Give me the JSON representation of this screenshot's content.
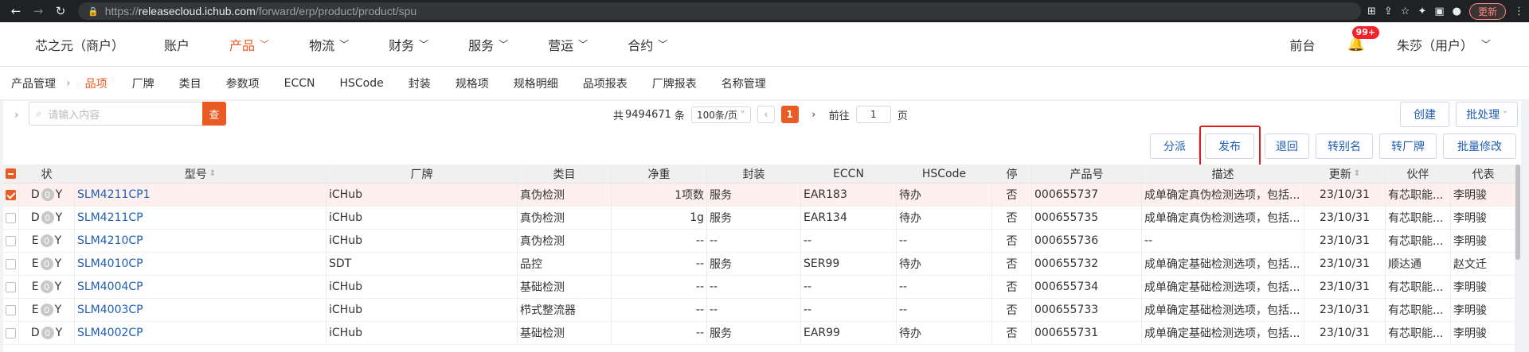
{
  "browser": {
    "url_prefix": "https://",
    "url_host": "releasecloud.ichub.com",
    "url_path": "/forward/erp/product/product/spu",
    "update_label": "更新"
  },
  "topnav": {
    "items": [
      {
        "label": "芯之元（商户）"
      },
      {
        "label": "账户"
      },
      {
        "label": "产品"
      },
      {
        "label": "物流"
      },
      {
        "label": "财务"
      },
      {
        "label": "服务"
      },
      {
        "label": "营运"
      },
      {
        "label": "合约"
      }
    ],
    "frontdesk": "前台",
    "badge": "99+",
    "user": "朱莎（用户）"
  },
  "subnav": {
    "root": "产品管理",
    "items": [
      "品项",
      "厂牌",
      "类目",
      "参数项",
      "ECCN",
      "HSCode",
      "封装",
      "规格项",
      "规格明细",
      "品项报表",
      "厂牌报表",
      "名称管理"
    ]
  },
  "toolbar": {
    "search_placeholder": "请输入内容",
    "search_btn": "查",
    "total_prefix": "共",
    "total": "9494671",
    "total_suffix": "条",
    "page_size": "100条/页",
    "current_page": "1",
    "goto_label": "前往",
    "goto_value": "1",
    "page_label": "页",
    "create": "创建",
    "batch": "批处理",
    "assign": "分派",
    "publish": "发布",
    "return": "退回",
    "alias": "转别名",
    "brand": "转厂牌",
    "batch_edit": "批量修改"
  },
  "table": {
    "headers": [
      "状",
      "型号",
      "厂牌",
      "类目",
      "净重",
      "封装",
      "ECCN",
      "HSCode",
      "停",
      "产品号",
      "描述",
      "更新",
      "伙伴",
      "代表"
    ],
    "rows": [
      {
        "sel": true,
        "s1": "D",
        "s2": "0",
        "s3": "Y",
        "model": "SLM4211CP1",
        "brand": "iCHub",
        "cat": "真伪检测",
        "weight": "1项数",
        "pkg": "服务",
        "eccn": "EAR183",
        "hs": "待办",
        "stop": "否",
        "pn": "000655737",
        "desc": "成单确定真伪检测选项，包括...",
        "upd": "23/10/31",
        "partner": "有芯职能...",
        "rep": "李明骏"
      },
      {
        "sel": false,
        "s1": "D",
        "s2": "0",
        "s3": "Y",
        "model": "SLM4211CP",
        "brand": "iCHub",
        "cat": "真伪检测",
        "weight": "1g",
        "pkg": "服务",
        "eccn": "EAR134",
        "hs": "待办",
        "stop": "否",
        "pn": "000655735",
        "desc": "成单确定真伪检测选项，包括...",
        "upd": "23/10/31",
        "partner": "有芯职能...",
        "rep": "李明骏"
      },
      {
        "sel": false,
        "s1": "E",
        "s2": "0",
        "s3": "Y",
        "model": "SLM4210CP",
        "brand": "iCHub",
        "cat": "真伪检测",
        "weight": "--",
        "pkg": "--",
        "eccn": "--",
        "hs": "--",
        "stop": "否",
        "pn": "000655736",
        "desc": "--",
        "upd": "23/10/31",
        "partner": "有芯职能...",
        "rep": "李明骏"
      },
      {
        "sel": false,
        "s1": "E",
        "s2": "0",
        "s3": "Y",
        "model": "SLM4010CP",
        "brand": "SDT",
        "cat": "品控",
        "weight": "--",
        "pkg": "服务",
        "eccn": "SER99",
        "hs": "待办",
        "stop": "否",
        "pn": "000655732",
        "desc": "成单确定基础检测选项，包括...",
        "upd": "23/10/31",
        "partner": "顺达通",
        "rep": "赵文迁"
      },
      {
        "sel": false,
        "s1": "E",
        "s2": "0",
        "s3": "Y",
        "model": "SLM4004CP",
        "brand": "iCHub",
        "cat": "基础检测",
        "weight": "--",
        "pkg": "--",
        "eccn": "--",
        "hs": "--",
        "stop": "否",
        "pn": "000655734",
        "desc": "成单确定基础检测选项，包括...",
        "upd": "23/10/31",
        "partner": "有芯职能...",
        "rep": "李明骏"
      },
      {
        "sel": false,
        "s1": "E",
        "s2": "0",
        "s3": "Y",
        "model": "SLM4003CP",
        "brand": "iCHub",
        "cat": "栉式整流器",
        "weight": "--",
        "pkg": "--",
        "eccn": "--",
        "hs": "--",
        "stop": "否",
        "pn": "000655733",
        "desc": "成单确定基础检测选项，包括...",
        "upd": "23/10/31",
        "partner": "有芯职能...",
        "rep": "李明骏"
      },
      {
        "sel": false,
        "s1": "D",
        "s2": "0",
        "s3": "Y",
        "model": "SLM4002CP",
        "brand": "iCHub",
        "cat": "基础检测",
        "weight": "--",
        "pkg": "服务",
        "eccn": "EAR99",
        "hs": "待办",
        "stop": "否",
        "pn": "000655731",
        "desc": "成单确定基础检测选项，包括...",
        "upd": "23/10/31",
        "partner": "有芯职能...",
        "rep": "李明骏"
      }
    ]
  },
  "colors": {
    "accent": "#ea5a23",
    "link": "#1f5fb4",
    "highlight": "#e01b1b"
  }
}
